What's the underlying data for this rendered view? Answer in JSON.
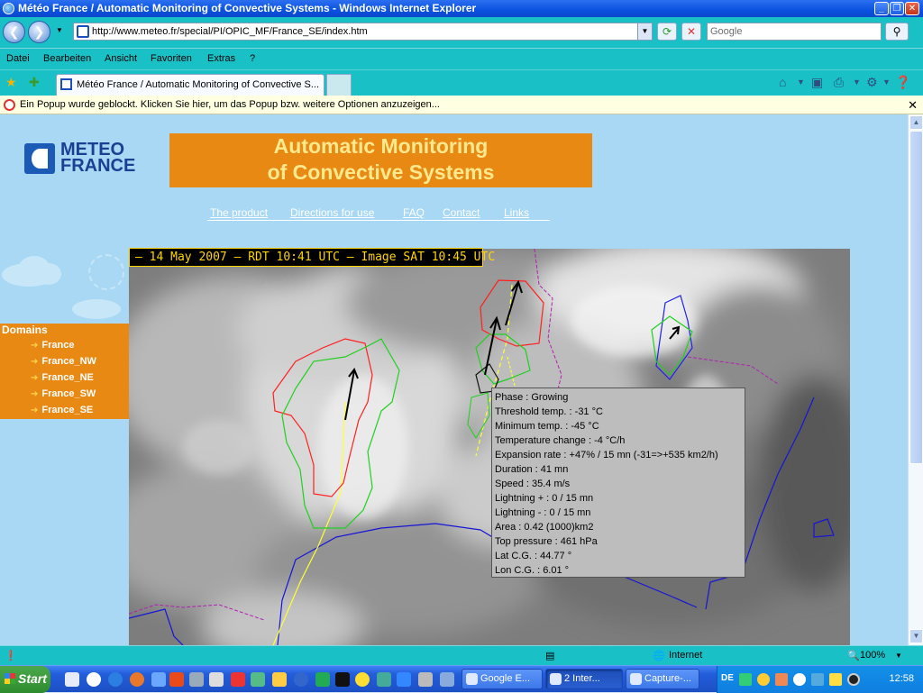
{
  "window": {
    "title": "Météo France / Automatic Monitoring of Convective Systems - Windows Internet Explorer",
    "min": "_",
    "restore": "❐",
    "close": "✕"
  },
  "address": {
    "url": "http://www.meteo.fr/special/PI/OPIC_MF/France_SE/index.htm",
    "search_placeholder": "Google"
  },
  "menu": [
    "Datei",
    "Bearbeiten",
    "Ansicht",
    "Favoriten",
    "Extras",
    "?"
  ],
  "tab": {
    "label": "Météo France / Automatic Monitoring of Convective S..."
  },
  "infobar": {
    "text": "Ein Popup wurde geblockt. Klicken Sie hier, um das Popup bzw. weitere Optionen anzuzeigen..."
  },
  "page": {
    "logo_line1": "METEO",
    "logo_line2": "FRANCE",
    "banner_line1": "Automatic Monitoring",
    "banner_line2": "of Convective Systems",
    "nav": [
      "The product",
      "Directions for use",
      "FAQ",
      "Contact",
      "Links"
    ],
    "domains_title": "Domains",
    "domains": [
      "France",
      "France_NW",
      "France_NE",
      "France_SW",
      "France_SE"
    ],
    "timestamp": " –  14 May 2007  –   RDT 10:41 UTC  –   Image SAT 10:45 UTC",
    "info": [
      "Phase : Growing",
      "Threshold temp.   : -31 °C",
      "Minimum temp.    : -45 °C",
      "Temperature change : -4 °C/h",
      "Expansion rate : +47% / 15 mn (-31=>+535 km2/h)",
      "Duration    : 41 mn",
      "Speed : 35.4 m/s",
      "Lightning + : 0 / 15 mn",
      "Lightning - : 0 / 15 mn",
      "Area : 0.42 (1000)km2",
      "Top pressure :   461 hPa",
      "Lat C.G. : 44.77 °",
      "Lon C.G. : 6.01 °"
    ]
  },
  "status": {
    "zone": "Internet",
    "zoom": "100%"
  },
  "taskbar": {
    "start": "Start",
    "apps": [
      "Google E...",
      "2 Inter...",
      "Capture-..."
    ],
    "lang": "DE",
    "clock": "12:58"
  }
}
